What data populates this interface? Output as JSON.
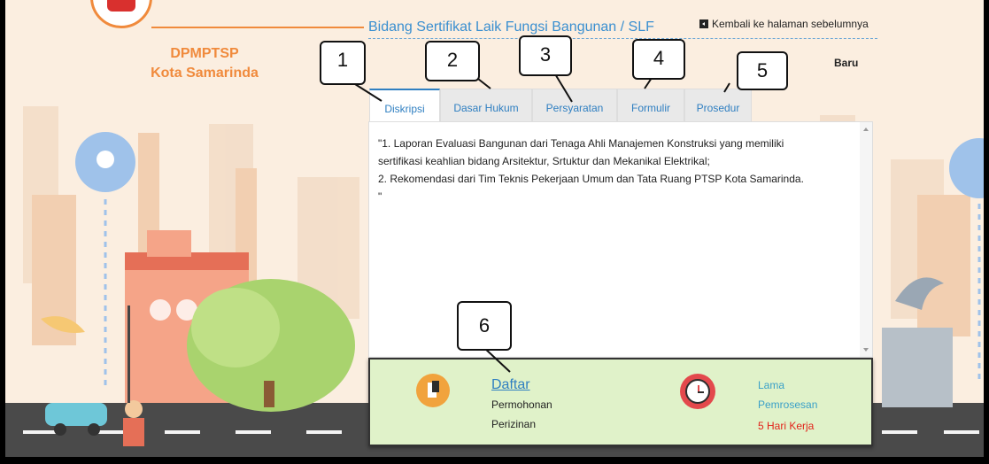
{
  "org": {
    "line1": "DPMPTSP",
    "line2": "Kota Samarinda"
  },
  "header": {
    "title": "Bidang Sertifikat Laik Fungsi Bangunan / SLF",
    "back_link": "Kembali ke halaman sebelumnya",
    "status": "Baru"
  },
  "tabs": [
    {
      "label": "Diskripsi",
      "active": true
    },
    {
      "label": "Dasar Hukum",
      "active": false
    },
    {
      "label": "Persyaratan",
      "active": false
    },
    {
      "label": "Formulir",
      "active": false
    },
    {
      "label": "Prosedur",
      "active": false
    }
  ],
  "content": {
    "line1": "\"1. Laporan Evaluasi Bangunan dari Tenaga Ahli Manajemen Konstruksi yang memiliki",
    "line2": "sertifikasi keahlian bidang Arsitektur, Srtuktur dan Mekanikal Elektrikal;",
    "line3": "2. Rekomendasi dari Tim Teknis Pekerjaan Umum dan Tata Ruang PTSP Kota Samarinda.",
    "line4": "\""
  },
  "action": {
    "daftar": "Daftar",
    "sub1": "Permohonan",
    "sub2": "Perizinan",
    "time_label1": "Lama",
    "time_label2": "Pemrosesan",
    "duration": "5 Hari Kerja"
  },
  "callouts": [
    "1",
    "2",
    "3",
    "4",
    "5",
    "6"
  ],
  "colors": {
    "accent": "#2f7fc1",
    "brand_orange": "#f08a3c",
    "panel_green": "#e0f2c9",
    "duration_red": "#e2231a"
  }
}
